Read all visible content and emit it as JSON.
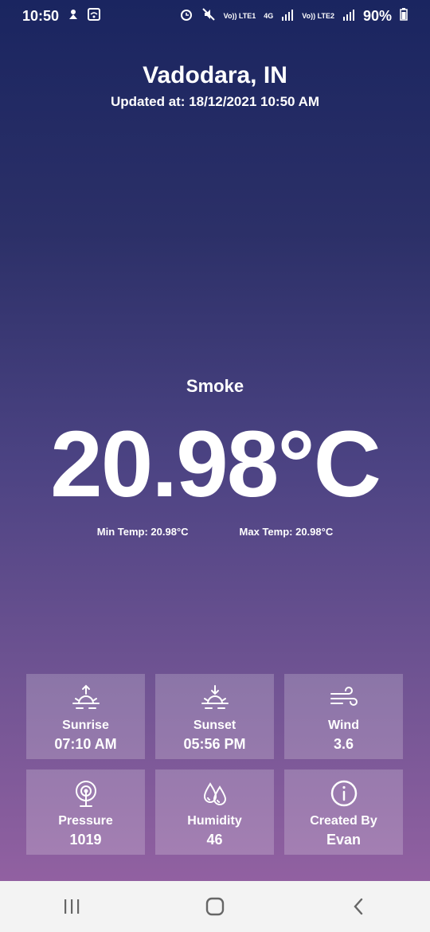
{
  "statusbar": {
    "time": "10:50",
    "net1": "Vo)) LTE1",
    "net2": "4G",
    "net3": "Vo)) LTE2",
    "battery": "90%"
  },
  "header": {
    "city": "Vadodara, IN",
    "updated": "Updated at: 18/12/2021 10:50 AM"
  },
  "weather": {
    "status": "Smoke",
    "temp": "20.98°C",
    "min_temp": "Min Temp: 20.98°C",
    "max_temp": "Max Temp: 20.98°C"
  },
  "cards": [
    {
      "label": "Sunrise",
      "value": "07:10 AM",
      "icon": "sunrise-icon"
    },
    {
      "label": "Sunset",
      "value": "05:56 PM",
      "icon": "sunset-icon"
    },
    {
      "label": "Wind",
      "value": "3.6",
      "icon": "wind-icon"
    },
    {
      "label": "Pressure",
      "value": "1019",
      "icon": "pressure-icon"
    },
    {
      "label": "Humidity",
      "value": "46",
      "icon": "humidity-icon"
    },
    {
      "label": "Created By",
      "value": "Evan",
      "icon": "info-icon"
    }
  ]
}
